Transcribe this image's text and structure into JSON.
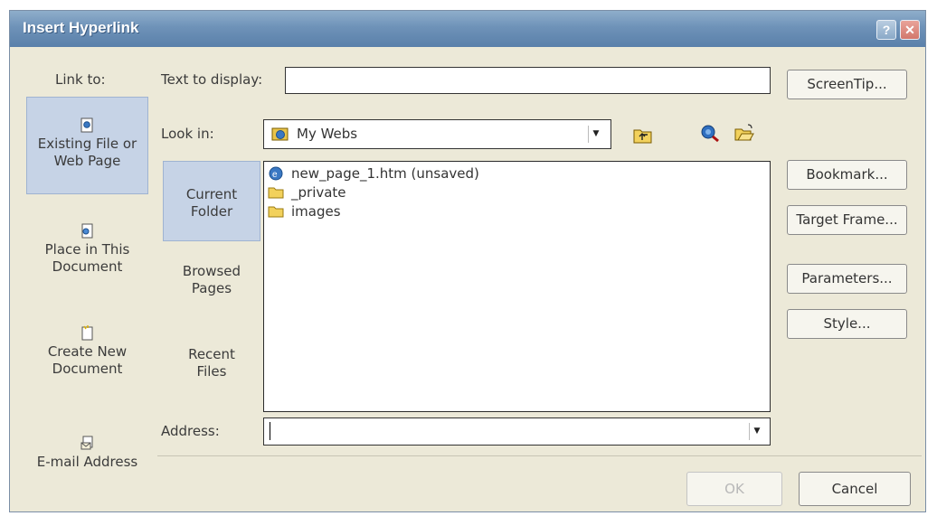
{
  "window": {
    "title": "Insert Hyperlink"
  },
  "link_to": {
    "label": "Link to:",
    "items": [
      {
        "line1": "Existing File or",
        "line2": "Web Page",
        "icon": "existing-file-icon",
        "selected": true
      },
      {
        "line1": "Place in This",
        "line2": "Document",
        "icon": "place-in-document-icon",
        "selected": false
      },
      {
        "line1": "Create New",
        "line2": "Document",
        "icon": "new-document-icon",
        "selected": false
      },
      {
        "line1": "E-mail Address",
        "line2": "",
        "icon": "email-icon",
        "selected": false
      }
    ]
  },
  "text_to_display": {
    "label": "Text to display:",
    "value": ""
  },
  "look_in": {
    "label": "Look in:",
    "value": "My Webs"
  },
  "pages": [
    {
      "line1": "Current",
      "line2": "Folder",
      "selected": true
    },
    {
      "line1": "Browsed",
      "line2": "Pages",
      "selected": false
    },
    {
      "line1": "Recent",
      "line2": "Files",
      "selected": false
    }
  ],
  "files": [
    {
      "name": "new_page_1.htm (unsaved)",
      "icon": "html-page-icon"
    },
    {
      "name": "_private",
      "icon": "folder-icon"
    },
    {
      "name": "images",
      "icon": "folder-icon"
    }
  ],
  "address": {
    "label": "Address:",
    "value": ""
  },
  "buttons": {
    "screentip": "ScreenTip...",
    "bookmark": "Bookmark...",
    "target_frame": "Target Frame...",
    "parameters": "Parameters...",
    "style": "Style...",
    "ok": "OK",
    "cancel": "Cancel"
  },
  "colors": {
    "title_bar": "#6e92b8",
    "dialog_bg": "#ece9d8",
    "selected_bg": "#c6d3e6"
  }
}
